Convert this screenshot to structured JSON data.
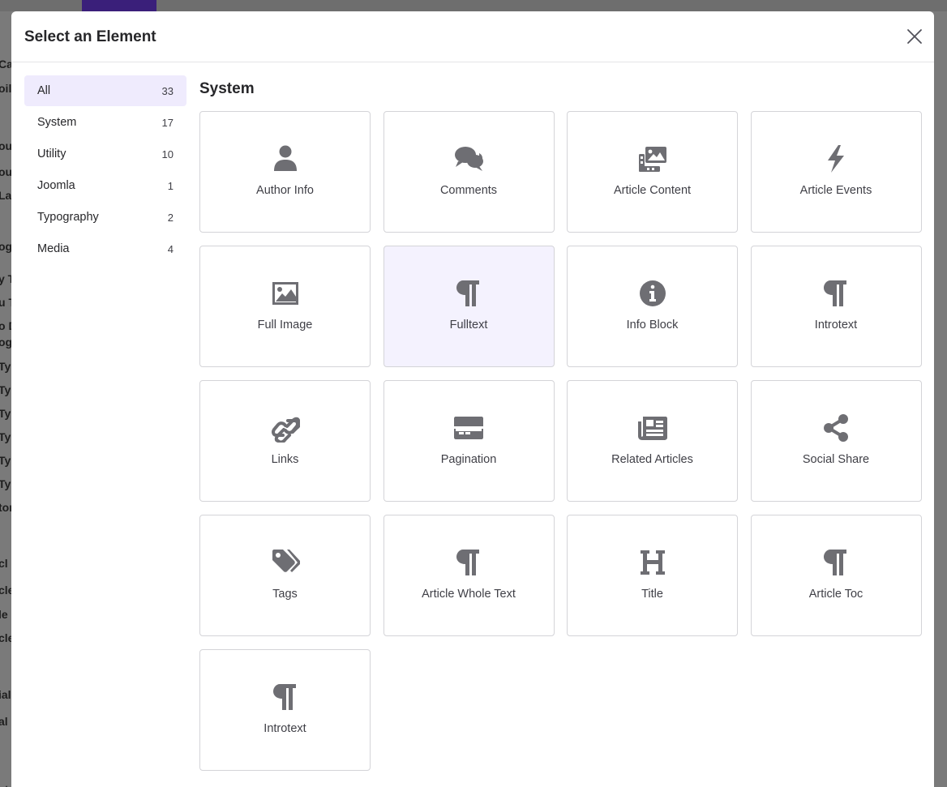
{
  "background": {
    "left_fragments": [
      "Ca",
      "oile",
      "ou",
      "out",
      "La",
      "og",
      "y T",
      "u T",
      "o D",
      "og",
      "Typ",
      "Typ",
      "Typ",
      "Typ",
      "Typ",
      "Typ",
      "tor",
      "cl",
      "cle",
      "le",
      "cle",
      "ial",
      "al",
      "sto"
    ]
  },
  "modal": {
    "title": "Select an Element",
    "close_icon": "close-icon"
  },
  "sidebar": {
    "items": [
      {
        "label": "All",
        "count": "33",
        "active": true
      },
      {
        "label": "System",
        "count": "17"
      },
      {
        "label": "Utility",
        "count": "10"
      },
      {
        "label": "Joomla",
        "count": "1"
      },
      {
        "label": "Typography",
        "count": "2"
      },
      {
        "label": "Media",
        "count": "4"
      }
    ]
  },
  "section": {
    "title": "System",
    "elements": [
      {
        "label": "Author Info",
        "icon": "user-icon"
      },
      {
        "label": "Comments",
        "icon": "comments-icon"
      },
      {
        "label": "Article Content",
        "icon": "photo-film-icon"
      },
      {
        "label": "Article Events",
        "icon": "bolt-icon"
      },
      {
        "label": "Full Image",
        "icon": "image-icon"
      },
      {
        "label": "Fulltext",
        "icon": "paragraph-icon",
        "active": true
      },
      {
        "label": "Info Block",
        "icon": "info-circle-icon"
      },
      {
        "label": "Introtext",
        "icon": "paragraph-icon"
      },
      {
        "label": "Links",
        "icon": "link-icon"
      },
      {
        "label": "Pagination",
        "icon": "pagination-icon"
      },
      {
        "label": "Related Articles",
        "icon": "newspaper-icon"
      },
      {
        "label": "Social Share",
        "icon": "share-nodes-icon"
      },
      {
        "label": "Tags",
        "icon": "tags-icon"
      },
      {
        "label": "Article Whole Text",
        "icon": "paragraph-icon"
      },
      {
        "label": "Title",
        "icon": "heading-icon"
      },
      {
        "label": "Article Toc",
        "icon": "paragraph-icon"
      },
      {
        "label": "Introtext",
        "icon": "paragraph-icon"
      }
    ]
  },
  "colors": {
    "accent_bg": "#efebfd",
    "card_active_bg": "#f4f2fe",
    "icon": "#6e6e73"
  }
}
